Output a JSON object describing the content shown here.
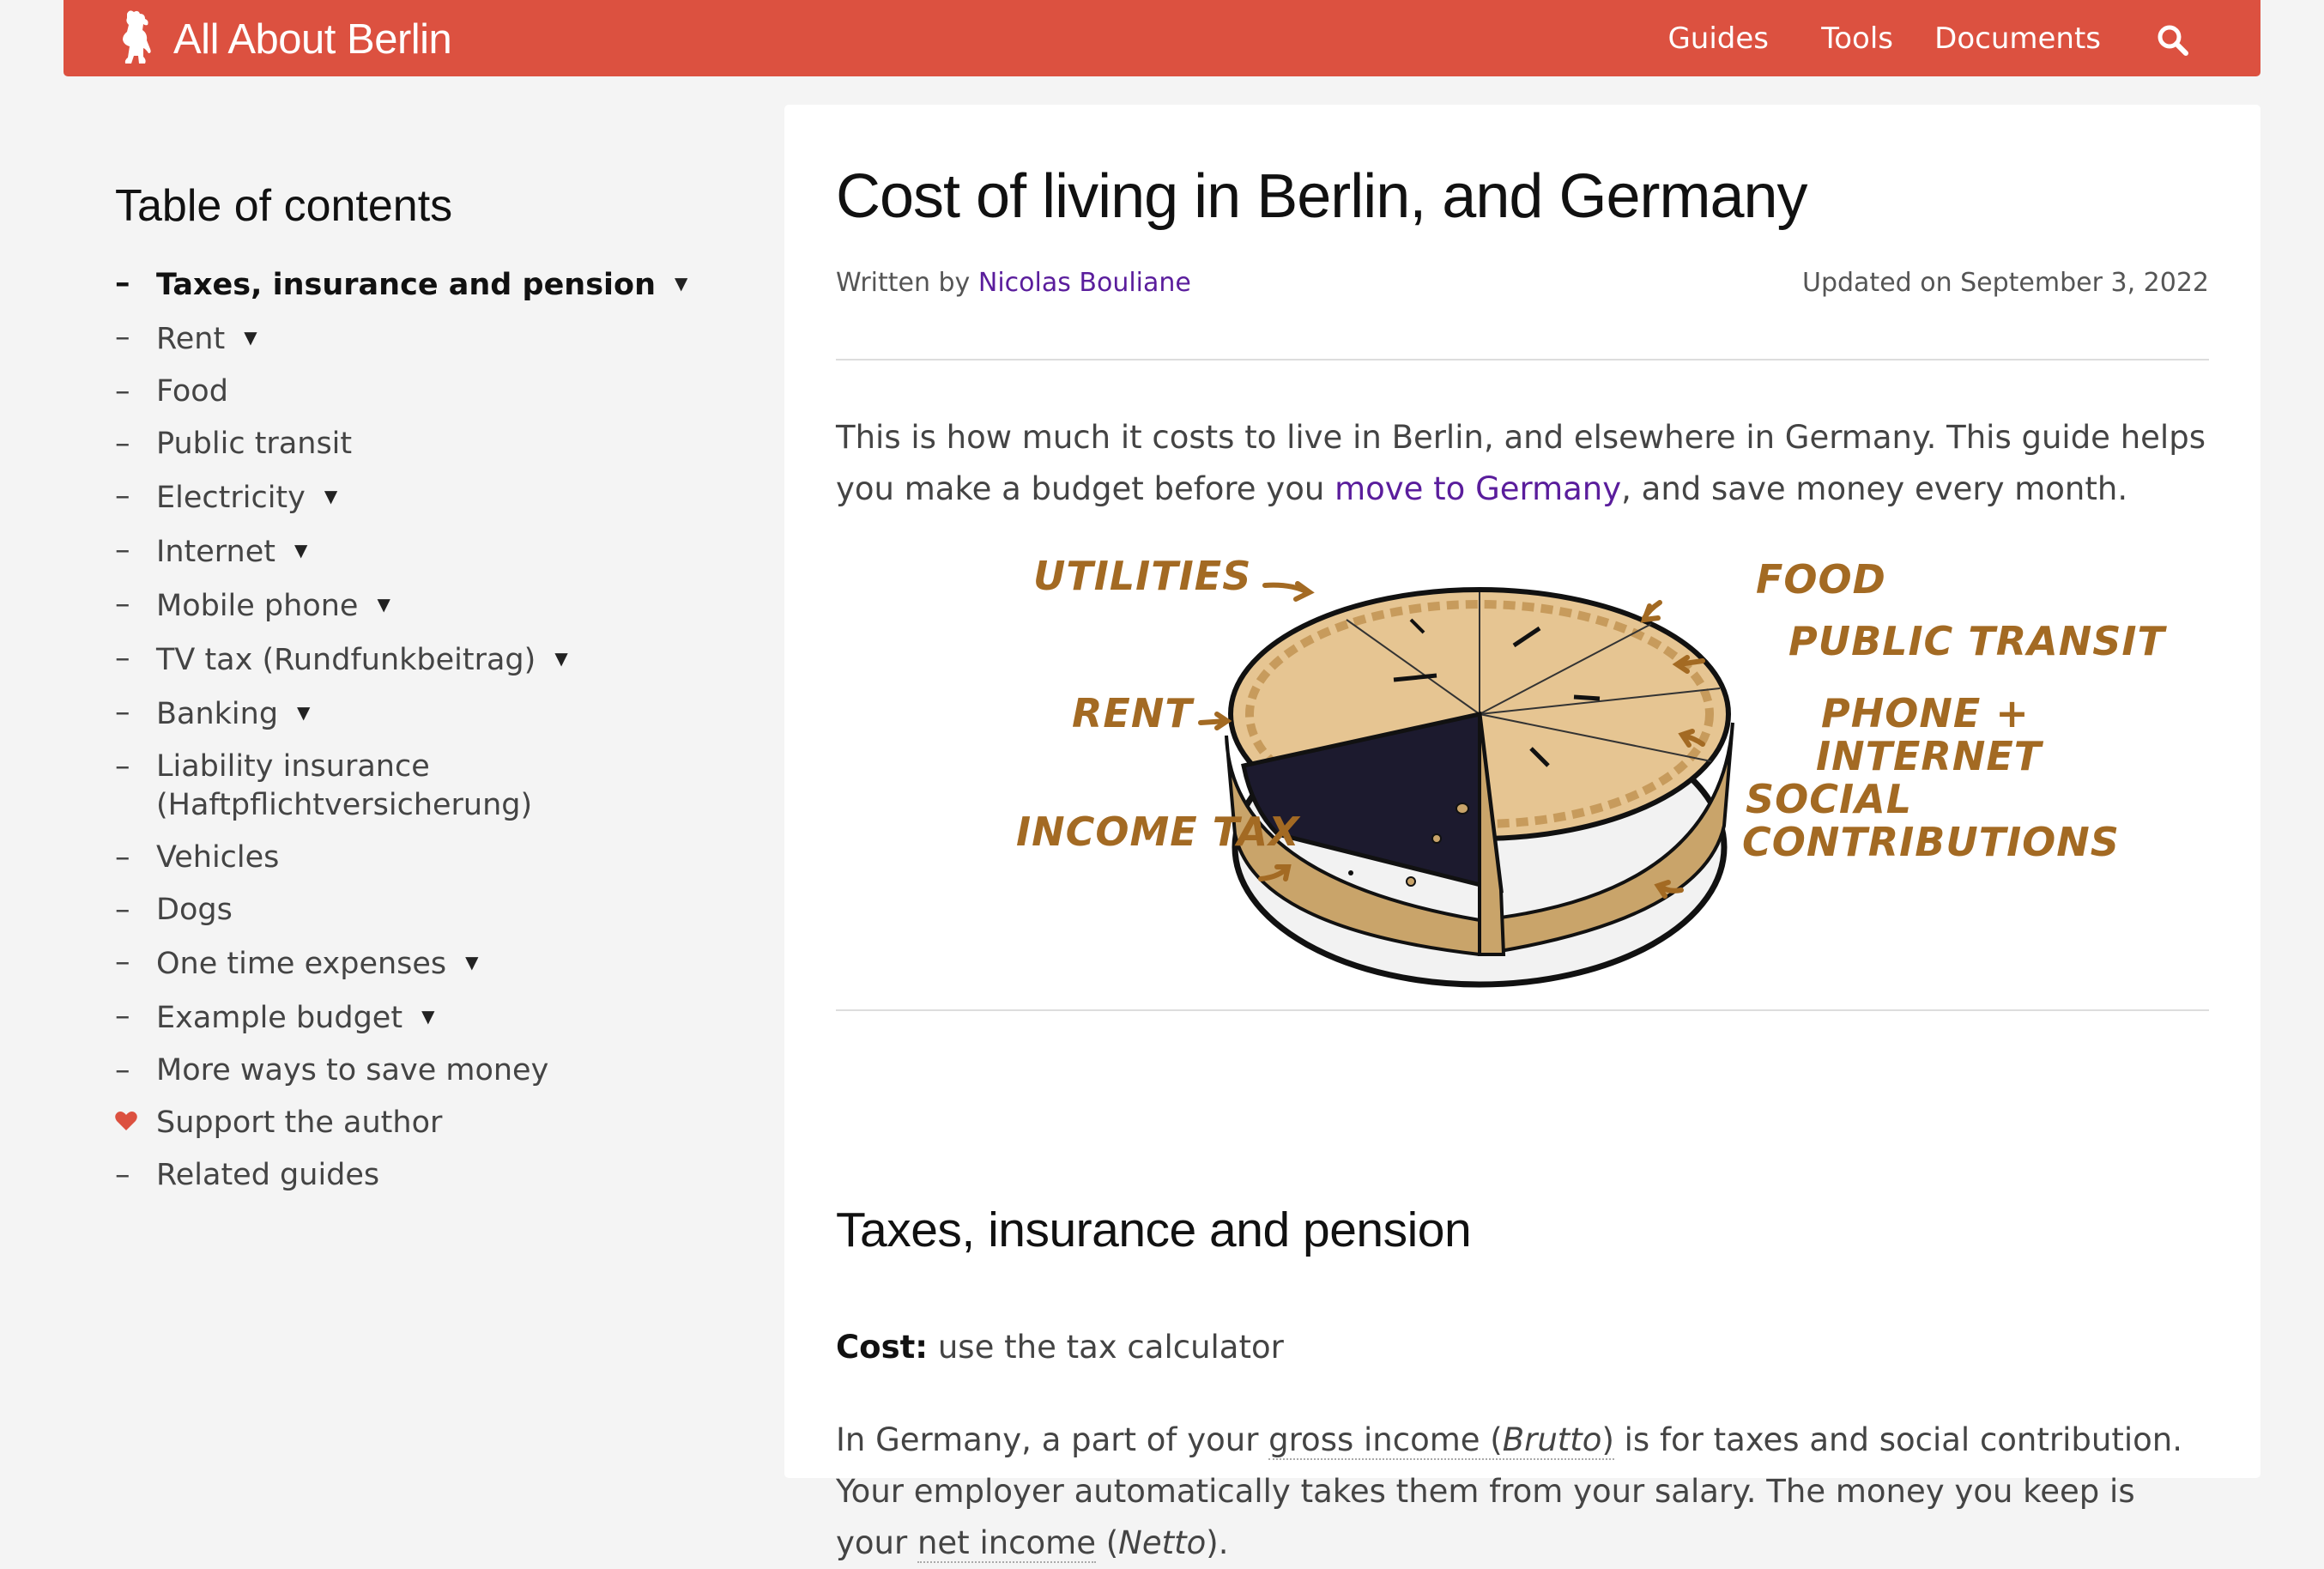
{
  "header": {
    "site_title": "All About Berlin",
    "nav": [
      "Guides",
      "Tools",
      "Documents"
    ],
    "search_icon": "search-icon",
    "brand_color": "#dc5140"
  },
  "toc": {
    "title": "Table of contents",
    "items": [
      {
        "label": "Taxes, insurance and pension",
        "caret": "▼",
        "active": true
      },
      {
        "label": "Rent",
        "caret": "▼"
      },
      {
        "label": "Food"
      },
      {
        "label": "Public transit"
      },
      {
        "label": "Electricity",
        "caret": "▼"
      },
      {
        "label": "Internet",
        "caret": "▼"
      },
      {
        "label": "Mobile phone",
        "caret": "▼"
      },
      {
        "label": "TV tax (Rundfunkbeitrag)",
        "caret": "▼"
      },
      {
        "label": "Banking",
        "caret": "▼"
      },
      {
        "label": "Liability insurance",
        "label2": "(Haftpflichtversicherung)"
      },
      {
        "label": "Vehicles"
      },
      {
        "label": "Dogs"
      },
      {
        "label": "One time expenses",
        "caret": "▼"
      },
      {
        "label": "Example budget",
        "caret": "▼"
      },
      {
        "label": "More ways to save money"
      },
      {
        "label": "Support the author",
        "icon": "heart-icon"
      },
      {
        "label": "Related guides"
      }
    ],
    "dash": "–"
  },
  "article": {
    "title": "Cost of living in Berlin, and Germany",
    "written_by": "Written by",
    "author": "Nicolas Bouliane",
    "updated": "Updated on September 3, 2022",
    "intro_before": "This is how much it costs to live in Berlin, and elsewhere in Germany. This guide helps you make a budget before you ",
    "intro_link": "move to Germany",
    "intro_after": ", and save money every month.",
    "pie_labels": {
      "utilities": "UTILITIES",
      "food": "FOOD",
      "public_transit": "PUBLIC TRANSIT",
      "rent": "RENT",
      "phone_internet_1": "PHONE +",
      "phone_internet_2": "INTERNET",
      "social_1": "SOCIAL",
      "social_2": "CONTRIBUTIONS",
      "income_tax": "INCOME TAX"
    },
    "section_title": "Taxes, insurance and pension",
    "cost_label": "Cost:",
    "cost_value": " use the tax calculator",
    "para_1": "In Germany, a part of your ",
    "para_gross": "gross income (",
    "para_brutto": "Brutto",
    "para_gross_end": ")",
    "para_2": " is for taxes and social contribution. Your employer automatically takes them from your salary. The money you keep is your ",
    "para_net": "net income",
    "para_3": " (",
    "para_netto": "Netto",
    "para_4": ")."
  }
}
